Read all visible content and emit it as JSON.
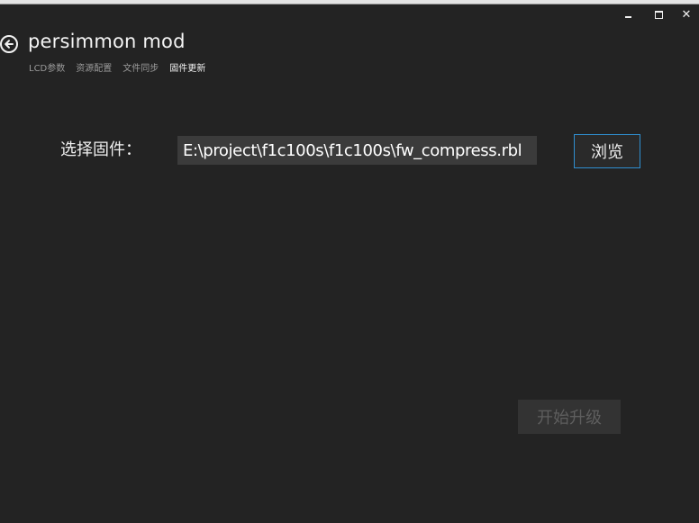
{
  "window": {
    "minimize_icon": "minimize-icon",
    "maximize_icon": "maximize-icon",
    "close_glyph": "✕"
  },
  "header": {
    "back_icon": "arrow-left-circle-icon",
    "title": "persimmon mod"
  },
  "tabs": [
    {
      "label": "LCD参数",
      "active": false
    },
    {
      "label": "资源配置",
      "active": false
    },
    {
      "label": "文件同步",
      "active": false
    },
    {
      "label": "固件更新",
      "active": true
    }
  ],
  "firmware": {
    "label": "选择固件：",
    "path_value": "E:\\project\\f1c100s\\f1c100s\\fw_compress.rbl",
    "browse_label": "浏览",
    "upgrade_label": "开始升级",
    "upgrade_enabled": false
  },
  "colors": {
    "background": "#232323",
    "accent_border": "#2f8fd1",
    "input_bg": "#3b3b3b",
    "disabled_text": "#5e5e5e"
  }
}
